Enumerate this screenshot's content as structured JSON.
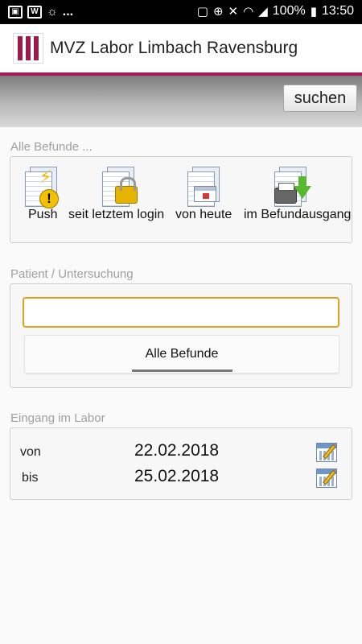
{
  "status_bar": {
    "battery": "100%",
    "time": "13:50",
    "overflow": "..."
  },
  "header": {
    "title": "MVZ Labor Limbach Ravensburg"
  },
  "toolbar": {
    "search_label": "suchen"
  },
  "all_reports": {
    "label": "Alle Befunde ...",
    "shortcuts": [
      {
        "label": "Push",
        "icon": "push-warning-icon"
      },
      {
        "label": "seit letztem login",
        "icon": "lock-document-icon"
      },
      {
        "label": "von heute",
        "icon": "calendar-document-icon"
      },
      {
        "label": "im Befundausgang",
        "icon": "printer-download-icon"
      }
    ]
  },
  "patient": {
    "label": "Patient / Untersuchung",
    "input_value": "",
    "filter_value": "Alle Befunde"
  },
  "lab_entry": {
    "label": "Eingang im Labor",
    "from_label": "von",
    "from_value": "22.02.2018",
    "to_label": "bis",
    "to_value": "25.02.2018"
  },
  "colors": {
    "accent": "#a3195b",
    "input_focus": "#e0a11a"
  }
}
